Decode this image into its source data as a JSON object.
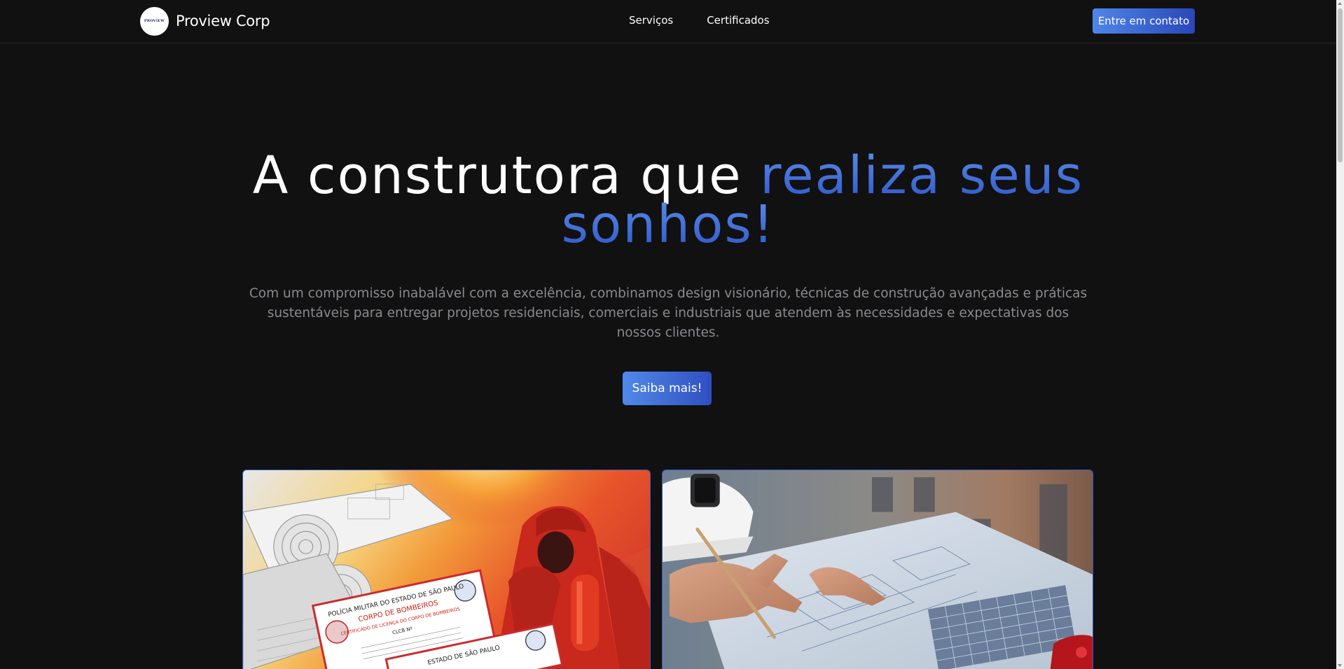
{
  "header": {
    "logo_text": "PROVIEW",
    "brand_name": "Proview Corp",
    "nav": [
      {
        "label": "Serviços"
      },
      {
        "label": "Certificados"
      }
    ],
    "contact_label": "Entre em contato"
  },
  "hero": {
    "title_plain": "A construtora que ",
    "title_accent_1": "realiza seus",
    "title_accent_2": "sonhos!",
    "subtitle": "Com um compromisso inabalável com a excelência, combinamos design visionário, técnicas de construção avançadas e práticas sustentáveis para entregar projetos residenciais, comerciais e industriais que atendem às necessidades e expectativas dos nossos clientes.",
    "cta_label": "Saiba mais!"
  },
  "cards": [
    {
      "image": "firefighter-certificate-image",
      "doc_line_1": "POLÍCIA MILITAR DO ESTADO DE SÃO PAULO",
      "doc_line_2": "CORPO DE BOMBEIROS",
      "doc_line_3": "CERTIFICADO DE LICENÇA DO CORPO DE BOMBEIROS",
      "doc_line_4": "CLCB Nº",
      "doc_line_5": "ESTADO DE SÃO PAULO"
    },
    {
      "image": "blueprint-planning-image"
    }
  ],
  "colors": {
    "background": "#111112",
    "accent_light": "#5b8fe8",
    "accent_dark": "#2f55c9",
    "muted_text": "#8a8a8f"
  }
}
